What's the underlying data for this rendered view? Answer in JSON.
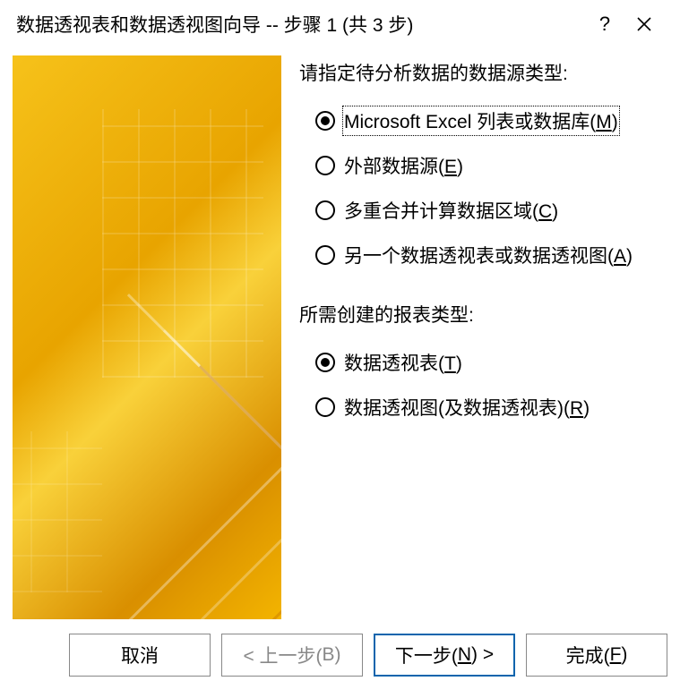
{
  "titlebar": {
    "title": "数据透视表和数据透视图向导 -- 步骤 1 (共 3 步)"
  },
  "source_group": {
    "label": "请指定待分析数据的数据源类型:",
    "options": [
      {
        "text": "Microsoft Excel 列表或数据库(",
        "accel": "M",
        "suffix": ")",
        "checked": true
      },
      {
        "text": "外部数据源(",
        "accel": "E",
        "suffix": ")",
        "checked": false
      },
      {
        "text": "多重合并计算数据区域(",
        "accel": "C",
        "suffix": ")",
        "checked": false
      },
      {
        "text": "另一个数据透视表或数据透视图(",
        "accel": "A",
        "suffix": ")",
        "checked": false
      }
    ]
  },
  "report_group": {
    "label": "所需创建的报表类型:",
    "options": [
      {
        "text": "数据透视表(",
        "accel": "T",
        "suffix": ")",
        "checked": true
      },
      {
        "text": "数据透视图(及数据透视表)(",
        "accel": "R",
        "suffix": ")",
        "checked": false
      }
    ]
  },
  "buttons": {
    "cancel": {
      "label": "取消"
    },
    "back": {
      "prefix": "< 上一步(",
      "accel": "B",
      "suffix": ")"
    },
    "next": {
      "prefix": "下一步(",
      "accel": "N",
      "suffix": ") >"
    },
    "finish": {
      "prefix": "完成(",
      "accel": "F",
      "suffix": ")"
    }
  }
}
